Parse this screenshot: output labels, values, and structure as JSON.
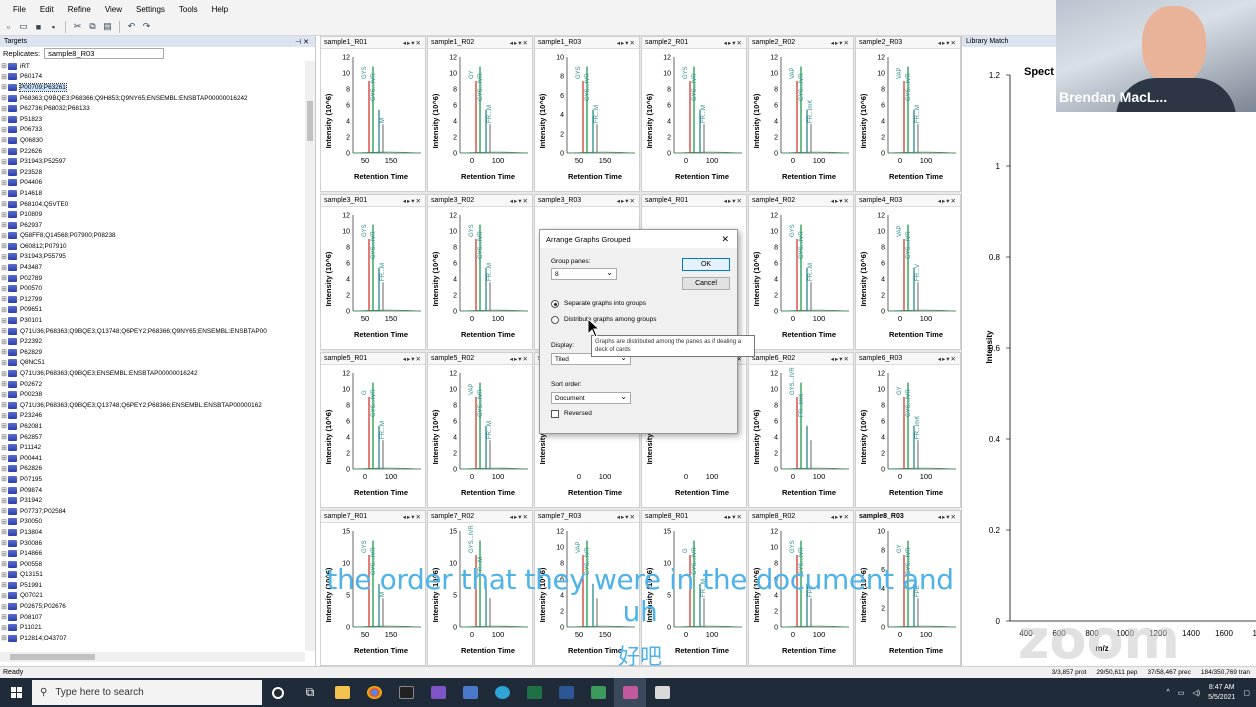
{
  "menu": [
    "File",
    "Edit",
    "Refine",
    "View",
    "Settings",
    "Tools",
    "Help"
  ],
  "targets": {
    "title": "Targets",
    "replicates_label": "Replicates:",
    "replicates_value": "sample8_R03",
    "items": [
      "iRT",
      "P60174",
      "P00709;P63261",
      "P68363;Q9BQE3;P68366;Q9H853;Q9NY65;ENSEMBL:ENSBTAP00000016242",
      "P62736;P68032;P68133",
      "P51823",
      "P06733",
      "Q06830",
      "P22626",
      "P31943;P52597",
      "P23528",
      "P04406",
      "P14618",
      "P68104;Q5VTE0",
      "P10809",
      "P62937",
      "Q58FF8;Q14568;P07900;P08238",
      "O60812;P07910",
      "P31943;P55795",
      "P43487",
      "P02789",
      "P00570",
      "P12799",
      "P09651",
      "P30101",
      "Q71U36;P68363;Q9BQE3;Q13748;Q6PEY2;P68366;Q9NY65;ENSEMBL:ENSBTAP00",
      "P22392",
      "P62829",
      "Q8NC51",
      "Q71U36;P68363;Q9BQE3;ENSEMBL:ENSBTAP00000016242",
      "P02672",
      "P00238",
      "Q71U36;P68363;Q9BQE3;Q13748;Q6PEY2;P68366;ENSEMBL:ENSBTAP00000162",
      "P23246",
      "P62081",
      "P62857",
      "P11142",
      "P00441",
      "P62826",
      "P07195",
      "P09874",
      "P31942",
      "P07737;P02584",
      "P30050",
      "P13804",
      "P30086",
      "P14866",
      "P00558",
      "Q13151",
      "P51991",
      "Q07021",
      "P02675;P02676",
      "P08107",
      "P11021",
      "P12814;O43707"
    ],
    "highlighted_index": 2
  },
  "panes": [
    {
      "title": "sample1_R01",
      "bold": false,
      "yticks": [
        "12",
        "10",
        "8",
        "6",
        "4",
        "2",
        "0"
      ],
      "xticks": [
        "50",
        "150"
      ],
      "labels": [
        "GYS",
        "GYS...IVR",
        "M"
      ]
    },
    {
      "title": "sample1_R02",
      "bold": false,
      "yticks": [
        "12",
        "10",
        "8",
        "6",
        "4",
        "2",
        "0"
      ],
      "xticks": [
        "0",
        "100"
      ],
      "labels": [
        "GY",
        "GYS...IVR",
        "FR...M"
      ]
    },
    {
      "title": "sample1_R03",
      "bold": false,
      "yticks": [
        "10",
        "8",
        "6",
        "4",
        "2",
        "0"
      ],
      "xticks": [
        "50",
        "150"
      ],
      "labels": [
        "GYS",
        "GYS...IVR",
        "FR...M"
      ]
    },
    {
      "title": "sample2_R01",
      "bold": false,
      "yticks": [
        "12",
        "10",
        "8",
        "6",
        "4",
        "2",
        "0"
      ],
      "xticks": [
        "0",
        "100"
      ],
      "labels": [
        "GYS",
        "GYS...IVR",
        "FR...M"
      ]
    },
    {
      "title": "sample2_R02",
      "bold": false,
      "yticks": [
        "12",
        "10",
        "8",
        "6",
        "4",
        "2",
        "0"
      ],
      "xticks": [
        "0",
        "100"
      ],
      "labels": [
        "VAP",
        "GYS...IVR",
        "FR...lmK"
      ]
    },
    {
      "title": "sample2_R03",
      "bold": false,
      "yticks": [
        "12",
        "10",
        "8",
        "6",
        "4",
        "2",
        "0"
      ],
      "xticks": [
        "0",
        "100"
      ],
      "labels": [
        "VAP",
        "GYS...IVR",
        "FR...M"
      ]
    },
    {
      "title": "sample3_R01",
      "bold": false,
      "yticks": [
        "12",
        "10",
        "8",
        "6",
        "4",
        "2",
        "0"
      ],
      "xticks": [
        "50",
        "150"
      ],
      "labels": [
        "GYS",
        "GYS...IVR",
        "FR...M"
      ]
    },
    {
      "title": "sample3_R02",
      "bold": false,
      "yticks": [
        "12",
        "10",
        "8",
        "6",
        "4",
        "2",
        "0"
      ],
      "xticks": [
        "0",
        "100"
      ],
      "labels": [
        "GYS",
        "GYS...IVR",
        "FR...M"
      ]
    },
    {
      "title": "sample3_R03",
      "bold": false,
      "yticks": [],
      "xticks": [],
      "labels": []
    },
    {
      "title": "sample4_R01",
      "bold": false,
      "yticks": [],
      "xticks": [],
      "labels": []
    },
    {
      "title": "sample4_R02",
      "bold": false,
      "yticks": [
        "12",
        "10",
        "8",
        "6",
        "4",
        "2",
        "0"
      ],
      "xticks": [
        "0",
        "100"
      ],
      "labels": [
        "GYS",
        "GYS...IVR",
        "FR...M"
      ]
    },
    {
      "title": "sample4_R03",
      "bold": false,
      "yticks": [
        "12",
        "10",
        "8",
        "6",
        "4",
        "2",
        "0"
      ],
      "xticks": [
        "0",
        "100"
      ],
      "labels": [
        "VAP",
        "GYS...IVR",
        "FR...V"
      ]
    },
    {
      "title": "sample5_R01",
      "bold": false,
      "yticks": [
        "12",
        "10",
        "8",
        "6",
        "4",
        "2",
        "0"
      ],
      "xticks": [
        "0",
        "100"
      ],
      "labels": [
        "G",
        "GYS...IVR",
        "FR...M"
      ]
    },
    {
      "title": "sample5_R02",
      "bold": false,
      "yticks": [
        "12",
        "10",
        "8",
        "6",
        "4",
        "2",
        "0"
      ],
      "xticks": [
        "0",
        "100"
      ],
      "labels": [
        "VAP",
        "GYS...IVR",
        "FR...M"
      ]
    },
    {
      "title": "sample5_R03",
      "bold": false,
      "yticks": [],
      "xticks": [
        "0",
        "100"
      ],
      "labels": [
        "GYS...IVR",
        "FR...M"
      ]
    },
    {
      "title": "sample6_R01",
      "bold": false,
      "yticks": [],
      "xticks": [
        "0",
        "100"
      ],
      "labels": [
        "GYS...IVR"
      ]
    },
    {
      "title": "sample6_R02",
      "bold": false,
      "yticks": [
        "12",
        "10",
        "8",
        "6",
        "4",
        "2",
        "0"
      ],
      "xticks": [
        "0",
        "100"
      ],
      "labels": [
        "GYS...IVR",
        "FR...lmK"
      ]
    },
    {
      "title": "sample6_R03",
      "bold": false,
      "yticks": [
        "12",
        "10",
        "8",
        "6",
        "4",
        "2",
        "0"
      ],
      "xticks": [
        "0",
        "100"
      ],
      "labels": [
        "GY",
        "GYS...IVR",
        "FR...lmK"
      ]
    },
    {
      "title": "sample7_R01",
      "bold": false,
      "yticks": [
        "15",
        "10",
        "5",
        "0"
      ],
      "xticks": [
        "50",
        "150"
      ],
      "labels": [
        "GYS",
        "GYS...IVR",
        "M"
      ]
    },
    {
      "title": "sample7_R02",
      "bold": false,
      "yticks": [
        "15",
        "10",
        "5",
        "0"
      ],
      "xticks": [
        "0",
        "100"
      ],
      "labels": [
        "GYS...IVR",
        "FR...M"
      ]
    },
    {
      "title": "sample7_R03",
      "bold": false,
      "yticks": [
        "12",
        "10",
        "8",
        "6",
        "4",
        "2",
        "0"
      ],
      "xticks": [
        "50",
        "150"
      ],
      "labels": [
        "VAP",
        "GYS...IVR"
      ]
    },
    {
      "title": "sample8_R01",
      "bold": false,
      "yticks": [
        "15",
        "10",
        "5",
        "0"
      ],
      "xticks": [
        "0",
        "100"
      ],
      "labels": [
        "G",
        "GYS...IVR",
        "FR...M"
      ]
    },
    {
      "title": "sample8_R02",
      "bold": false,
      "yticks": [
        "12",
        "10",
        "8",
        "6",
        "4",
        "2",
        "0"
      ],
      "xticks": [
        "0",
        "100"
      ],
      "labels": [
        "GYS",
        "GYS...IVR",
        "FPE"
      ]
    },
    {
      "title": "sample8_R03",
      "bold": true,
      "yticks": [
        "10",
        "8",
        "6",
        "4",
        "2",
        "0"
      ],
      "xticks": [
        "0",
        "100"
      ],
      "labels": [
        "GY",
        "GYS...IVR",
        "FPE"
      ]
    }
  ],
  "pane_ylabel": "Intensity (10^6)",
  "pane_xlabel": "Retention Time",
  "library_match": {
    "title": "Library Match",
    "spectrum_title": "Spect",
    "ylabel": "Intensity",
    "yticks": [
      "1.2",
      "1",
      "0.8",
      "0.6",
      "0.4",
      "0.2",
      "0"
    ],
    "xticks": [
      "400",
      "600",
      "800",
      "1000",
      "1200",
      "1400",
      "1600",
      "18"
    ],
    "xlabel": "m/z"
  },
  "dialog": {
    "title": "Arrange Graphs Grouped",
    "group_panes_label": "Group panes:",
    "group_panes_value": "8",
    "ok": "OK",
    "cancel": "Cancel",
    "radio1": "Separate graphs into groups",
    "radio2": "Distribute graphs among groups",
    "display_label": "Display:",
    "display_value": "Tiled",
    "sort_label": "Sort order:",
    "sort_value": "Document",
    "reversed_label": "Reversed",
    "tooltip": "Graphs are distributed among the panes as if dealing a deck of cards"
  },
  "webcam": {
    "name": "Brendan MacL..."
  },
  "status": {
    "left": "Ready",
    "prot": "3/3,857 prot",
    "pep": "29/50,611 pep",
    "prec": "37/58,467 prec",
    "tran": "184/350,769 tran"
  },
  "taskbar": {
    "search_placeholder": "Type here to search",
    "time": "8:47 AM",
    "date": "5/5/2021"
  },
  "subtitle": {
    "en": "the order that they were in the document and uh",
    "zh": "好吧"
  },
  "watermark": "zoom",
  "colors": {
    "accent": "#0078d7",
    "peak_green": "#1a9a4a",
    "peak_red": "#d13a2c",
    "subtitle": "#4fb3e8"
  }
}
